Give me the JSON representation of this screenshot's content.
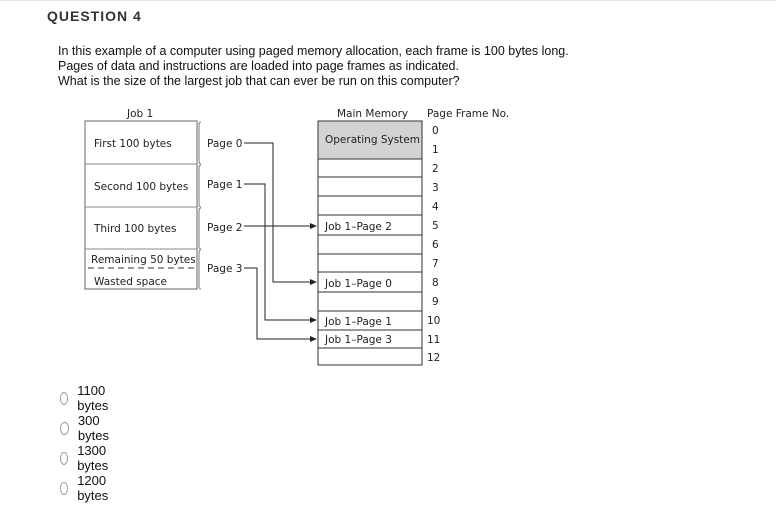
{
  "question": {
    "title": "QUESTION 4",
    "text_lines": [
      "In this example of a computer using paged memory allocation, each frame is 100 bytes long.",
      "Pages of data and instructions are loaded into page frames as indicated.",
      "What is the size of the largest job that can ever be run on this computer?"
    ]
  },
  "figure": {
    "job_title": "Job 1",
    "main_memory_title": "Main Memory",
    "page_frame_title": "Page Frame No.",
    "job_segments": [
      "First 100 bytes",
      "Second 100 bytes",
      "Third 100 bytes",
      "Remaining 50 bytes",
      "Wasted space"
    ],
    "pages": [
      "Page 0",
      "Page 1",
      "Page 2",
      "Page 3"
    ],
    "memory_frames": [
      {
        "frame": "0",
        "label": "Operating System"
      },
      {
        "frame": "1",
        "label": ""
      },
      {
        "frame": "2",
        "label": ""
      },
      {
        "frame": "3",
        "label": ""
      },
      {
        "frame": "4",
        "label": ""
      },
      {
        "frame": "5",
        "label": "Job 1–Page 2"
      },
      {
        "frame": "6",
        "label": ""
      },
      {
        "frame": "7",
        "label": ""
      },
      {
        "frame": "8",
        "label": "Job 1–Page 0"
      },
      {
        "frame": "9",
        "label": ""
      },
      {
        "frame": "10",
        "label": "Job 1–Page 1"
      },
      {
        "frame": "11",
        "label": "Job 1–Page 3"
      },
      {
        "frame": "12",
        "label": ""
      }
    ],
    "os_fill": "#d3d3d3"
  },
  "answers": [
    {
      "label": "1100 bytes",
      "selected": false
    },
    {
      "label": "300 bytes",
      "selected": false
    },
    {
      "label": "1300 bytes",
      "selected": false
    },
    {
      "label": "1200 bytes",
      "selected": false
    }
  ]
}
